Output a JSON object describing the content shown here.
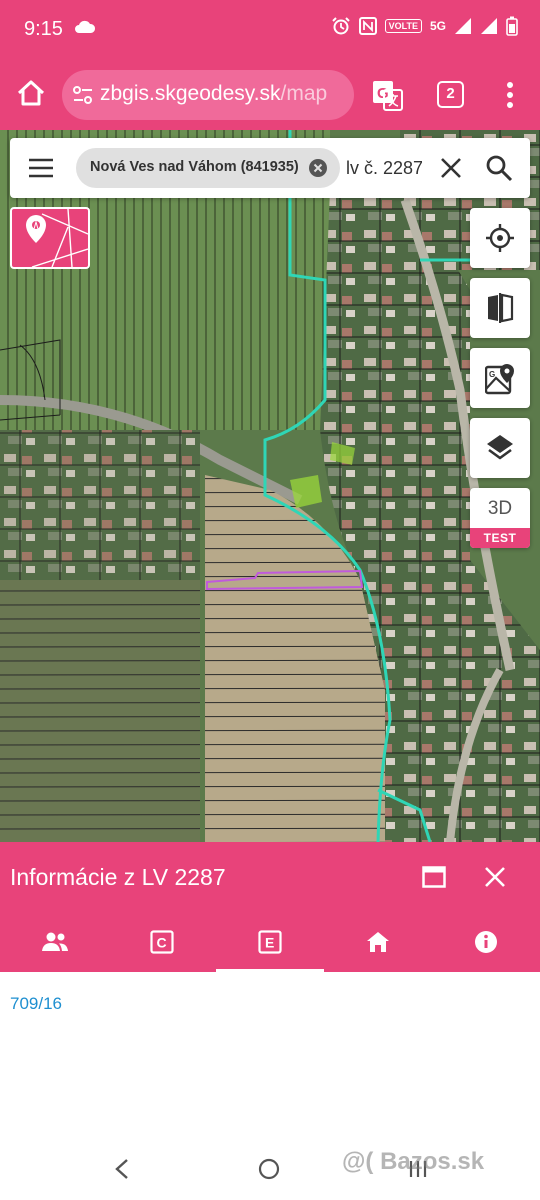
{
  "status_bar": {
    "time": "9:15",
    "network": "5G",
    "volte": "VOLTE"
  },
  "browser": {
    "url_host": "zbgis.skgeodesy.sk",
    "url_path": "/map",
    "tab_count": "2"
  },
  "search": {
    "chip_label": "Nová Ves nad Váhom (841935)",
    "query": "lv č. 2287"
  },
  "map_buttons": {
    "three_d_label": "3D",
    "three_d_badge": "TEST"
  },
  "panel": {
    "title": "Informácie z LV 2287",
    "tabs": [
      {
        "icon": "people-icon"
      },
      {
        "icon": "c-letter-icon"
      },
      {
        "icon": "e-letter-icon",
        "active": true
      },
      {
        "icon": "building-icon"
      },
      {
        "icon": "info-icon"
      }
    ],
    "parcel": "709/16"
  },
  "watermark": "@( Bazos.sk",
  "colors": {
    "accent": "#e8437a",
    "link": "#1e8fd0",
    "boundary": "#2fd6b6",
    "selected_parcel": "#c05adc"
  }
}
